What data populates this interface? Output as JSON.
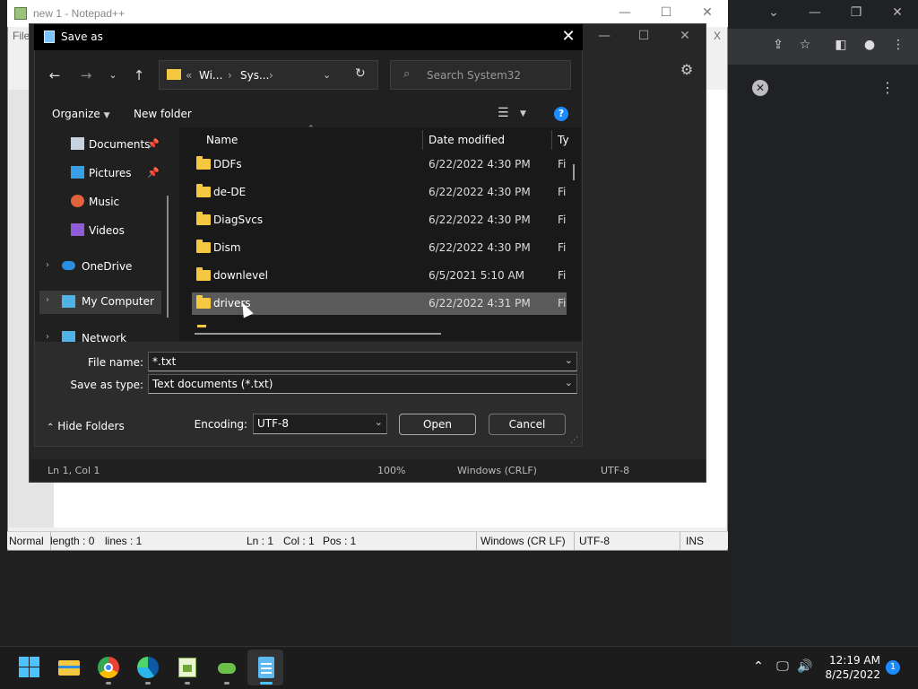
{
  "chrome": {
    "icons": [
      "chevron-down-icon",
      "minimize-icon",
      "restore-icon",
      "close-icon",
      "share-icon",
      "star-icon",
      "sidebar-icon",
      "profile-icon",
      "more-icon"
    ],
    "close_chip": "✕",
    "more": "⋮"
  },
  "notepadpp": {
    "title": "new 1 - Notepad++",
    "menu_first": "File",
    "menu_x": "X",
    "status": {
      "mode": "Normal",
      "length": "length : 0",
      "lines": "lines : 1",
      "ln": "Ln : 1",
      "col": "Col : 1",
      "pos": "Pos : 1",
      "eol": "Windows (CR LF)",
      "encoding": "UTF-8",
      "ins": "INS"
    }
  },
  "notepad": {
    "status": {
      "position": "Ln 1, Col 1",
      "zoom": "100%",
      "eol": "Windows (CRLF)",
      "encoding": "UTF-8"
    }
  },
  "dialog": {
    "title": "Save as",
    "address": {
      "overflow": "«",
      "crumb1": "Wi...",
      "sep1": "›",
      "crumb2": "Sys...",
      "sep2": "›"
    },
    "search_placeholder": "Search System32",
    "organize": "Organize",
    "new_folder": "New folder",
    "help": "?",
    "nav": [
      {
        "label": "Documents",
        "pinned": true
      },
      {
        "label": "Pictures",
        "pinned": true
      },
      {
        "label": "Music",
        "pinned": false
      },
      {
        "label": "Videos",
        "pinned": false
      },
      {
        "label": "OneDrive",
        "pinned": false
      },
      {
        "label": "My Computer",
        "pinned": false
      },
      {
        "label": "Network",
        "pinned": false
      }
    ],
    "columns": {
      "name": "Name",
      "date": "Date modified",
      "type": "Ty"
    },
    "files": [
      {
        "name": "DDFs",
        "date": "6/22/2022 4:30 PM",
        "type": "Fi"
      },
      {
        "name": "de-DE",
        "date": "6/22/2022 4:30 PM",
        "type": "Fi"
      },
      {
        "name": "DiagSvcs",
        "date": "6/22/2022 4:30 PM",
        "type": "Fi"
      },
      {
        "name": "Dism",
        "date": "6/22/2022 4:30 PM",
        "type": "Fi"
      },
      {
        "name": "downlevel",
        "date": "6/5/2021 5:10 AM",
        "type": "Fi"
      },
      {
        "name": "drivers",
        "date": "6/22/2022 4:31 PM",
        "type": "Fi"
      }
    ],
    "selected_file": "drivers",
    "file_name_label": "File name:",
    "file_name_value": "*.txt",
    "save_type_label": "Save as type:",
    "save_type_value": "Text documents (*.txt)",
    "encoding_label": "Encoding:",
    "encoding_value": "UTF-8",
    "open": "Open",
    "cancel": "Cancel",
    "hide_folders": "Hide Folders"
  },
  "taskbar": {
    "apps": [
      "windows-start-icon",
      "file-explorer-icon",
      "chrome-icon",
      "edge-icon",
      "notepadpp-icon",
      "lizard-app-icon",
      "notepad-icon"
    ],
    "time": "12:19 AM",
    "date": "8/25/2022",
    "notifications": "1"
  },
  "colors": {
    "accent": "#1a8cff",
    "folder": "#f5c842"
  }
}
